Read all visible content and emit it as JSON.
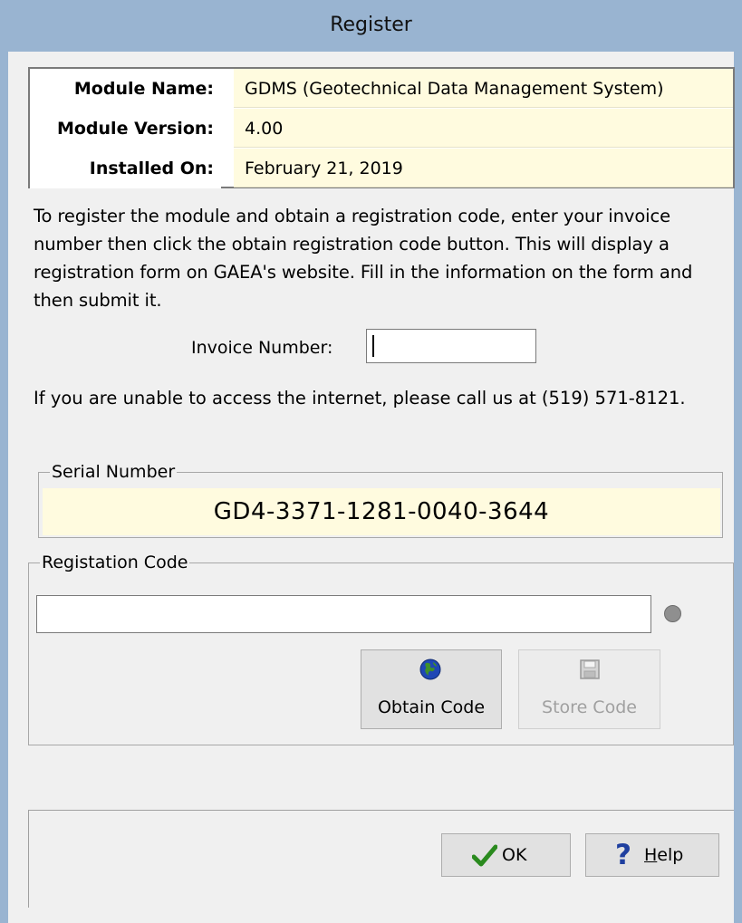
{
  "window": {
    "title": "Register"
  },
  "module_info": {
    "rows": [
      {
        "label": "Module Name:",
        "value": "GDMS (Geotechnical Data Management System)"
      },
      {
        "label": "Module Version:",
        "value": "4.00"
      },
      {
        "label": "Installed On:",
        "value": "February 21, 2019"
      }
    ]
  },
  "instructions": "To register the module and obtain a registration code, enter your invoice number then click the obtain registration code button. This will display a registration form on GAEA's website. Fill in the information on the form and then submit it.",
  "invoice": {
    "label": "Invoice Number:",
    "value": ""
  },
  "phone_note": "If you are unable to access the internet, please call us at (519) 571-8121.",
  "serial": {
    "title": "Serial Number",
    "value": "GD4-3371-1281-0040-3644"
  },
  "registration": {
    "title": "Registation Code",
    "value": "",
    "obtain_label": "Obtain Code",
    "store_label": "Store Code"
  },
  "buttons": {
    "ok": "OK",
    "help_first": "H",
    "help_rest": "elp"
  },
  "icons": {
    "obtain": "globe-icon",
    "store": "floppy-disk-icon",
    "ok": "checkmark-icon",
    "help": "question-mark-icon",
    "status": "status-indicator-icon"
  },
  "colors": {
    "titlebar": "#99b4d1",
    "value_bg": "#fffbdf",
    "ok_check": "#2a8a1e",
    "help_mark": "#1f3f9f"
  }
}
